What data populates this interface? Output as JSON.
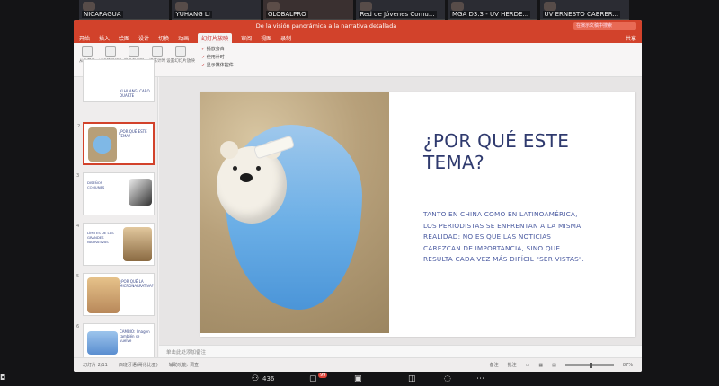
{
  "participants": [
    {
      "name": "NICARAGUA"
    },
    {
      "name": "YUHANG LI"
    },
    {
      "name": "GLOBALPRO"
    },
    {
      "name": "Red de Jóvenes Comu..."
    },
    {
      "name": "MGA D3.3 - UV HERDE..."
    },
    {
      "name": "UV ERNESTO CABRER..."
    }
  ],
  "window": {
    "title": "De la visión panorámica a la narrativa detallada",
    "search_placeholder": "在演示文稿中搜索",
    "share_label": "共享",
    "menu": [
      "开始",
      "插入",
      "绘图",
      "设计",
      "切换",
      "动画",
      "幻灯片放映",
      "审阅",
      "视图",
      "录制"
    ],
    "selected_menu_index": 6
  },
  "ribbon": {
    "buttons": [
      "从头开始",
      "从当前幻灯片",
      "演示者视图",
      "排练计时",
      "设置幻灯片放映"
    ],
    "checks": [
      "播放旁白",
      "使用计时",
      "显示媒体控件"
    ]
  },
  "thumbnails": [
    {
      "num": "",
      "title": "YI HUANG, CARO DUARTE"
    },
    {
      "num": "2",
      "title": "¿POR QUÉ ESTE TEMA?"
    },
    {
      "num": "3",
      "title": "DISEÑOS COMUNES"
    },
    {
      "num": "4",
      "title": "LÍMITES DE LAS GRANDES NARRATIVAS"
    },
    {
      "num": "5",
      "title": "¿POR QUÉ LA MICRONARRATIVA?"
    },
    {
      "num": "6",
      "title": "CAMBIO: Imagen también se vuelve"
    }
  ],
  "slide": {
    "title": "¿POR QUÉ ESTE TEMA?",
    "body": "TANTO EN CHINA COMO EN LATINOAMÉRICA, LOS PERIODISTAS SE ENFRENTAN A LA MISMA REALIDAD: NO ES QUE LAS NOTICIAS CAREZCAN DE IMPORTANCIA, SINO QUE RESULTA CADA VEZ MÁS DIFÍCIL \"SER VISTAS\"."
  },
  "notes_placeholder": "单击此处添加备注",
  "status": {
    "slide_counter": "幻灯片 2/11",
    "language": "西班牙语(哥伦比亚)",
    "accessibility": "辅助功能: 调查",
    "notes_label": "备注",
    "comments_label": "批注",
    "zoom": "87%"
  },
  "meeting": {
    "participant_count": "436",
    "chat_badge": "99"
  },
  "colors": {
    "accent": "#d2422b",
    "title_text": "#2f3a6e",
    "body_text": "#4a5aa0"
  }
}
